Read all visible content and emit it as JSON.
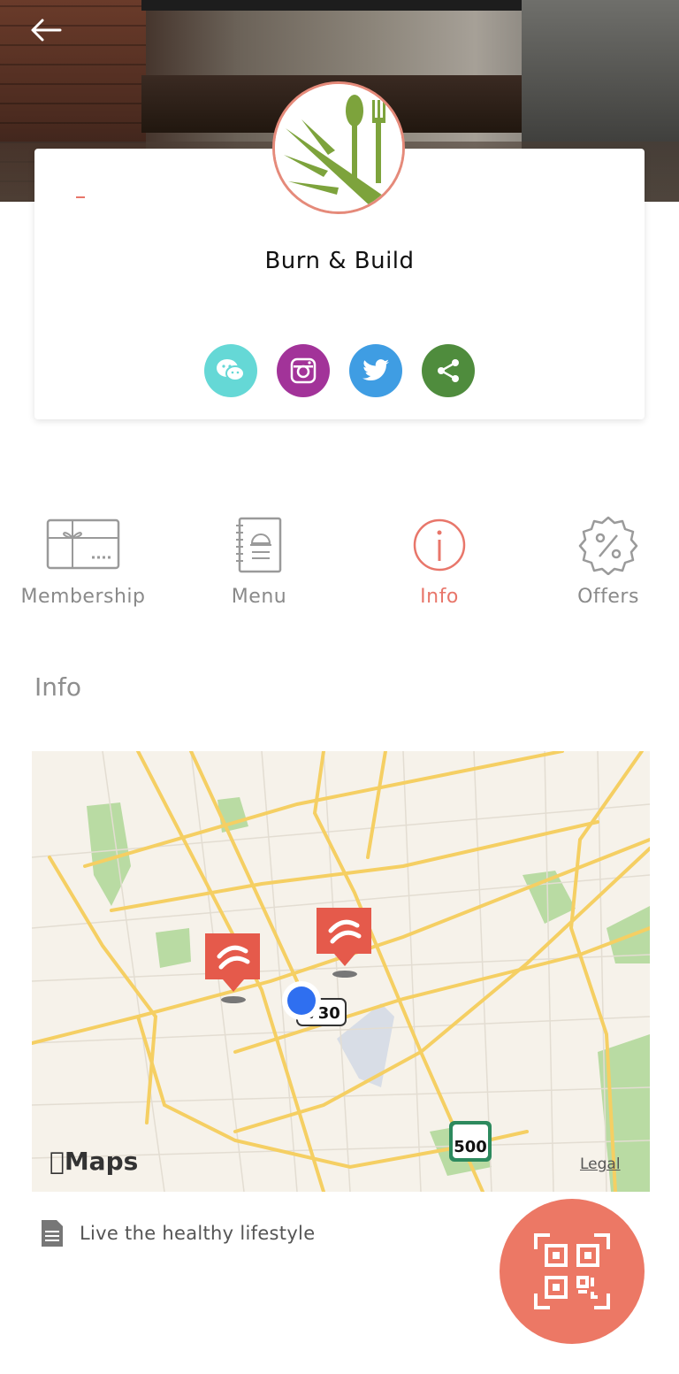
{
  "header": {
    "back_icon": "arrow-left-icon"
  },
  "restaurant": {
    "name": "Burn & Build",
    "logo_icon": "leaf-cutlery-logo"
  },
  "social": [
    {
      "name": "wechat",
      "icon": "wechat-icon",
      "color": "#65d8d6"
    },
    {
      "name": "instagram",
      "icon": "instagram-icon",
      "color": "#a23399"
    },
    {
      "name": "twitter",
      "icon": "twitter-icon",
      "color": "#3f9de3"
    },
    {
      "name": "share",
      "icon": "share-icon",
      "color": "#4f8c3d"
    }
  ],
  "tabs": [
    {
      "label": "Membership",
      "icon": "gift-card-icon",
      "active": false
    },
    {
      "label": "Menu",
      "icon": "menu-book-icon",
      "active": false
    },
    {
      "label": "Info",
      "icon": "info-icon",
      "active": true
    },
    {
      "label": "Offers",
      "icon": "discount-badge-icon",
      "active": false
    }
  ],
  "info": {
    "title": "Info",
    "map": {
      "brand": "Maps",
      "legal": "Legal",
      "route_badge_1": "730",
      "route_badge_2": "500"
    },
    "description": "Live the healthy lifestyle"
  },
  "colors": {
    "accent": "#e8766a",
    "fab": "#ec7865"
  },
  "fab": {
    "icon": "qr-code-icon"
  }
}
